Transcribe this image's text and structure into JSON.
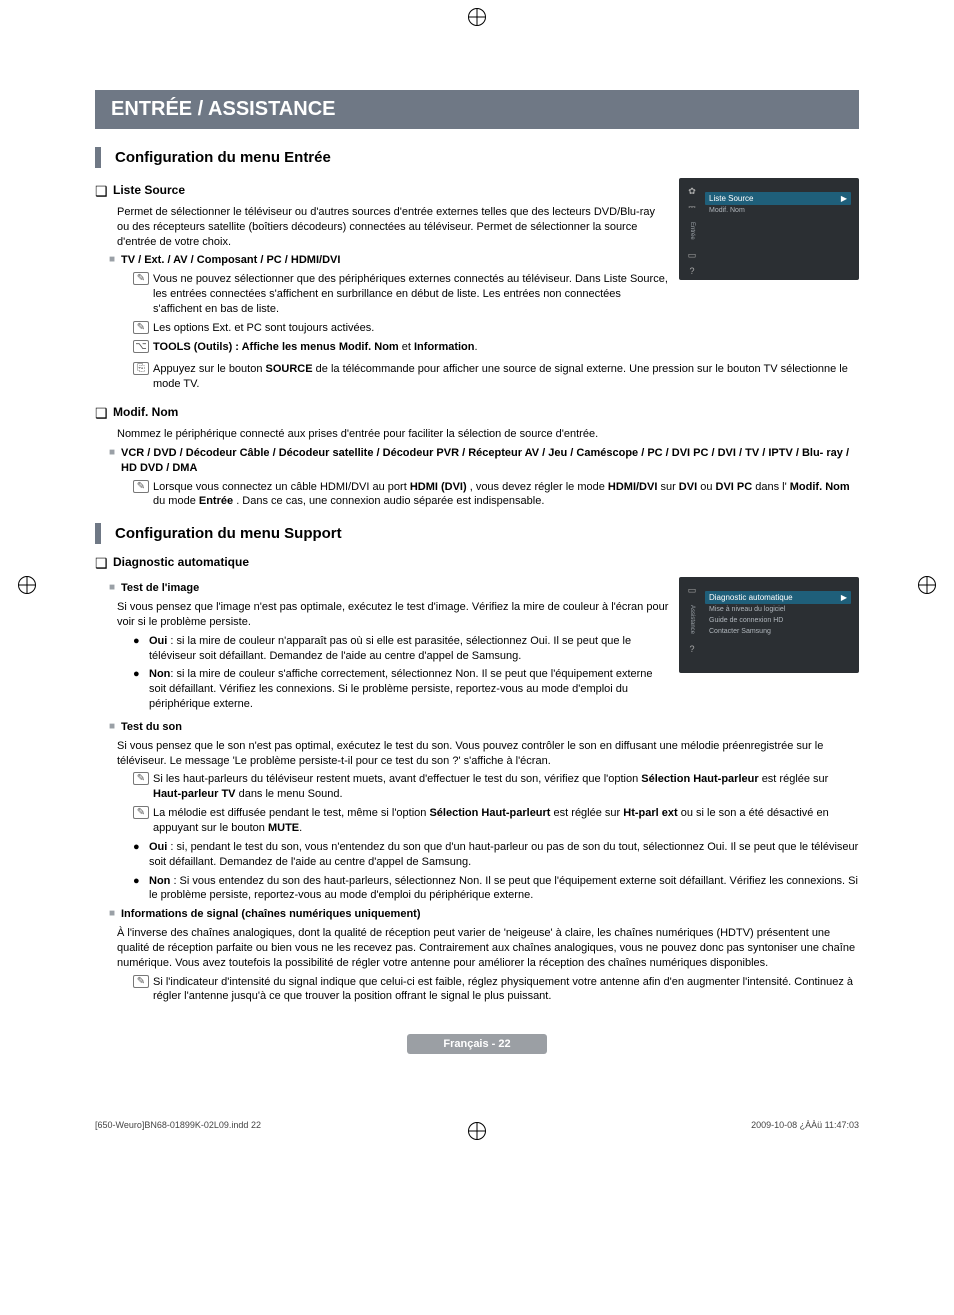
{
  "banner": "ENTRÉE / ASSISTANCE",
  "section1": {
    "title": "Configuration du menu Entrée",
    "liste_source": {
      "heading": "Liste Source",
      "desc": "Permet de sélectionner le téléviseur ou d'autres sources d'entrée externes telles que des lecteurs DVD/Blu-ray ou des récepteurs satellite (boîtiers décodeurs) connectées au téléviseur. Permet de sélectionner la source d'entrée de votre choix.",
      "sub_heading": "TV / Ext. / AV / Composant / PC / HDMI/DVI",
      "n1": "Vous ne pouvez sélectionner que des périphériques externes connectés au téléviseur. Dans Liste Source, les entrées connectées s'affichent en surbrillance en début de liste. Les entrées non connectées s'affichent en bas de liste.",
      "n2": "Les options Ext. et PC sont toujours activées.",
      "n3_pre": "TOOLS (Outils) : Affiche les menus ",
      "n3_b1": "Modif. Nom",
      "n3_mid": " et ",
      "n3_b2": "Information",
      "n4_pre": "Appuyez sur le bouton ",
      "n4_b": "SOURCE",
      "n4_post": " de la télécommande pour afficher une source de signal externe. Une pression sur le bouton TV sélectionne le mode TV."
    },
    "modif_nom": {
      "heading": "Modif. Nom",
      "desc": "Nommez le périphérique connecté aux prises d'entrée pour faciliter la sélection de source d'entrée.",
      "sub_heading": "VCR / DVD / Décodeur Câble / Décodeur satellite / Décodeur PVR / Récepteur AV / Jeu / Caméscope / PC / DVI PC / DVI / TV / IPTV / Blu- ray / HD DVD / DMA",
      "n1_pre": "Lorsque vous connectez un câble HDMI/DVI au port ",
      "n1_b1": "HDMI (DVI)",
      "n1_mid1": ", vous devez régler le mode ",
      "n1_b2": "HDMI/DVI",
      "n1_mid2": " sur ",
      "n1_b3": "DVI",
      "n1_mid3": " ou ",
      "n1_b4": "DVI PC",
      "n1_mid4": " dans l'",
      "n1_b5": "Modif. Nom",
      "n1_mid5": " du mode ",
      "n1_b6": "Entrée",
      "n1_post": ". Dans ce cas, une connexion audio séparée est indispensable."
    }
  },
  "section2": {
    "title": "Configuration du menu Support",
    "diag": {
      "heading": "Diagnostic automatique",
      "test_image": {
        "heading": "Test de l'image",
        "desc": "Si vous pensez que l'image n'est pas optimale, exécutez le test d'image. Vérifiez la mire de couleur à l'écran pour voir si le problème persiste.",
        "b1_pre": "Oui",
        "b1_post": " : si la mire de couleur n'apparaît pas où si elle est parasitée, sélectionnez Oui. Il se peut que le téléviseur soit défaillant. Demandez de l'aide au centre d'appel de Samsung.",
        "b2_pre": "Non",
        "b2_post": ": si la mire de couleur s'affiche correctement, sélectionnez Non. Il se peut que l'équipement externe soit défaillant. Vérifiez les connexions. Si le problème persiste, reportez-vous au mode d'emploi du périphérique externe."
      },
      "test_son": {
        "heading": "Test du son",
        "desc": "Si vous pensez que le son n'est pas optimal, exécutez le test du son. Vous pouvez contrôler le son en diffusant une mélodie préenregistrée sur le téléviseur. Le message 'Le problème persiste-t-il pour ce test du son ?' s'affiche à l'écran.",
        "n1_pre": "Si les haut-parleurs du téléviseur restent muets, avant d'effectuer le test du son, vérifiez que l'option ",
        "n1_b1": "Sélection Haut-parleur",
        "n1_mid": " est réglée sur ",
        "n1_b2": "Haut-parleur TV",
        "n1_post": " dans le menu Sound.",
        "n2_pre": "La mélodie est diffusée pendant le test, même si l'option ",
        "n2_b1": "Sélection Haut-parleurt",
        "n2_mid": " est réglée sur ",
        "n2_b2": "Ht-parl ext",
        "n2_mid2": " ou si le son a été désactivé en appuyant sur le bouton ",
        "n2_b3": "MUTE",
        "b1_pre": "Oui",
        "b1_post": " : si, pendant le test du son, vous n'entendez du son que d'un haut-parleur ou pas de son du tout, sélectionnez Oui. Il se peut que le téléviseur soit défaillant. Demandez de l'aide au centre d'appel de Samsung.",
        "b2_pre": "Non",
        "b2_post": " : Si vous entendez du son des haut-parleurs, sélectionnez Non. Il se peut que l'équipement externe soit défaillant. Vérifiez les connexions. Si le problème persiste, reportez-vous au mode d'emploi du périphérique externe."
      },
      "signal": {
        "heading": "Informations de signal (chaînes numériques uniquement)",
        "desc": "À l'inverse des chaînes analogiques, dont la qualité de réception peut varier de 'neigeuse' à claire, les chaînes numériques (HDTV) présentent une qualité de réception parfaite ou bien vous ne les recevez pas. Contrairement aux chaînes analogiques, vous ne pouvez donc pas syntoniser une chaîne numérique. Vous avez toutefois la possibilité de régler votre antenne pour améliorer la réception des chaînes numériques disponibles.",
        "n1": "Si l'indicateur d'intensité du signal indique que celui-ci est faible, réglez physiquement votre antenne afin d'en augmenter l'intensité. Continuez à régler l'antenne jusqu'à ce que trouver la position offrant le signal le plus puissant."
      }
    }
  },
  "osd1": {
    "tab": "Entrée",
    "hl": "Liste Source",
    "item": "Modif. Nom",
    "arrow": "▶"
  },
  "osd2": {
    "tab": "Assistance",
    "hl": "Diagnostic automatique",
    "i1": "Mise à niveau du logiciel",
    "i2": "Guide de connexion HD",
    "i3": "Contacter Samsung",
    "arrow": "▶"
  },
  "footer": "Français - 22",
  "print": {
    "left": "[650-Weuro]BN68-01899K-02L09.indd   22",
    "right": "2009-10-08   ¿ÀÀü 11:47:03"
  },
  "glyph": {
    "q": "❑",
    "sq": "■",
    "note": "✎",
    "tools": "⌥",
    "remote": "⎘",
    "bullet": "●"
  }
}
